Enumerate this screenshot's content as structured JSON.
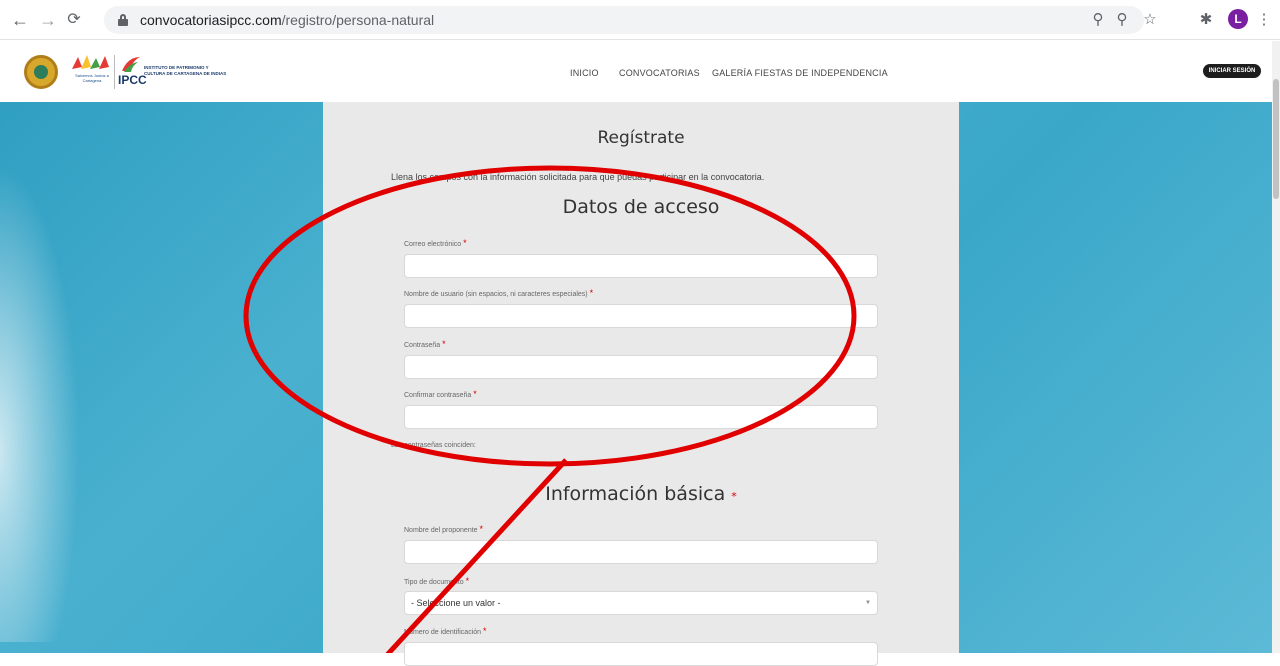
{
  "browser": {
    "back_icon": "arrow-left-icon",
    "forward_icon": "arrow-right-icon",
    "reload_icon": "reload-icon",
    "url_host": "convocatoriasipcc.com",
    "url_path": "/registro/persona-natural",
    "profile_initial": "L"
  },
  "header": {
    "logo_center_text": "Salvemos Juntos a Cartagena",
    "ipcc_name": "INSTITUTO DE PATRIMONIO Y CULTURA DE CARTAGENA DE INDIAS",
    "ipcc_short": "IPCC",
    "nav": [
      "INICIO",
      "CONVOCATORIAS",
      "GALERÍA FIESTAS DE INDEPENDENCIA"
    ],
    "login_label": "INICIAR SESIÓN"
  },
  "form": {
    "title": "Regístrate",
    "intro": "Llena los campos con la información solicitada para que puedas participar en la convocatoria.",
    "access_section": "Datos de acceso",
    "email_label": "Correo electrónico",
    "username_label": "Nombre de usuario (sin espacios, ni caracteres especiales)",
    "password_label": "Contraseña",
    "confirm_label": "Confirmar contraseña",
    "match_text": "Las contraseñas coinciden:",
    "required_mark": "*",
    "basic_section": "Información básica",
    "proponent_label": "Nombre del proponente",
    "doc_type_label": "Tipo de documento",
    "doc_type_value": "- Seleccione un valor -",
    "id_number_label": "Número de identificación"
  },
  "colors": {
    "annotation": "#e00000",
    "panel": "#e9e9e9",
    "background_sky": "#3aa7c9"
  }
}
